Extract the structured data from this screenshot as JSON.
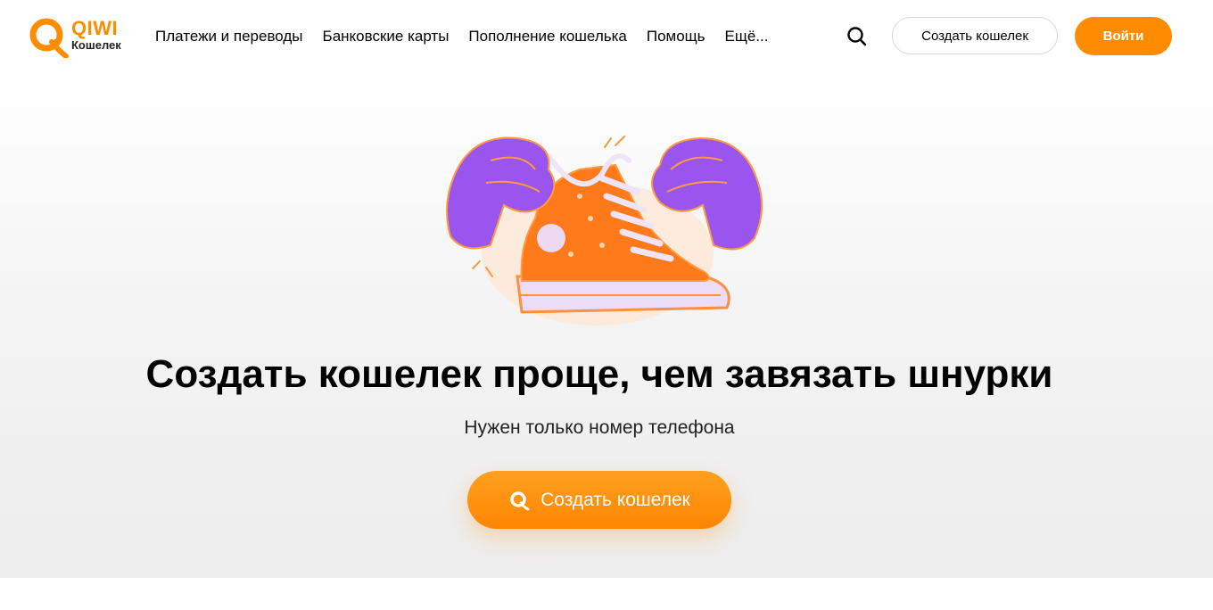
{
  "header": {
    "logo": {
      "word": "QIWI",
      "sub": "Кошелек"
    },
    "nav": [
      {
        "label": "Платежи и переводы"
      },
      {
        "label": "Банковские карты"
      },
      {
        "label": "Пополнение кошелька"
      },
      {
        "label": "Помощь"
      },
      {
        "label": "Ещё..."
      }
    ],
    "search_icon": "search-icon",
    "create_wallet_label": "Создать кошелек",
    "login_label": "Войти"
  },
  "hero": {
    "title": "Создать кошелек проще, чем завязать шнурки",
    "subtitle": "Нужен только номер телефона",
    "cta_label": "Создать кошелек",
    "cta_icon": "qiwi-logo-icon"
  },
  "colors": {
    "brand_orange": "#ff8c00",
    "purple": "#9b55ee",
    "text": "#000000"
  }
}
